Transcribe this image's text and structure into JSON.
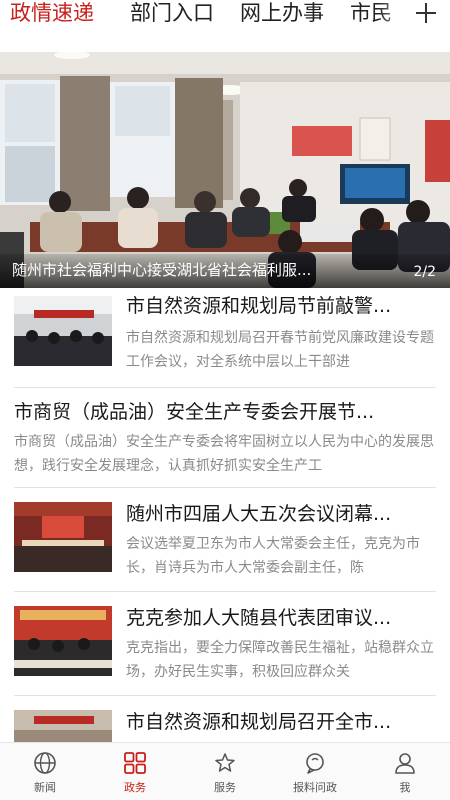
{
  "tabs": [
    {
      "label": "政情速递",
      "active": true
    },
    {
      "label": "部门入口",
      "active": false
    },
    {
      "label": "网上办事",
      "active": false
    },
    {
      "label": "市民",
      "active": false
    }
  ],
  "banner": {
    "caption": "随州市社会福利中心接受湖北省社会福利服...",
    "pager": "2/2"
  },
  "news": [
    {
      "title": "市自然资源和规划局节前敲警...",
      "summary": "市自然资源和规划局召开春节前党风廉政建设专题工作会议，对全系统中层以上干部进",
      "has_thumb": true
    },
    {
      "title": "市商贸（成品油）安全生产专委会开展节...",
      "summary": "市商贸（成品油）安全生产专委会将牢固树立以人民为中心的发展思想，践行安全发展理念，认真抓好抓实安全生产工",
      "has_thumb": false
    },
    {
      "title": "随州市四届人大五次会议闭幕...",
      "summary": "会议选举夏卫东为市人大常委会主任，克克为市长，肖诗兵为市人大常委会副主任，陈",
      "has_thumb": true
    },
    {
      "title": "克克参加人大随县代表团审议...",
      "summary": "克克指出，要全力保障改善民生福祉，站稳群众立场，办好民生实事，积极回应群众关",
      "has_thumb": true
    },
    {
      "title": "市自然资源和规划局召开全市...",
      "summary": "",
      "has_thumb": true
    }
  ],
  "bottom_nav": [
    {
      "label": "新闻",
      "icon": "globe-icon",
      "active": false
    },
    {
      "label": "政务",
      "icon": "grid-icon",
      "active": true
    },
    {
      "label": "服务",
      "icon": "service-icon",
      "active": false
    },
    {
      "label": "报料问政",
      "icon": "chat-icon",
      "active": false
    },
    {
      "label": "我",
      "icon": "user-icon",
      "active": false
    }
  ],
  "colors": {
    "accent": "#c8201a",
    "text": "#1a1a1a",
    "muted": "#8a8a8a"
  }
}
